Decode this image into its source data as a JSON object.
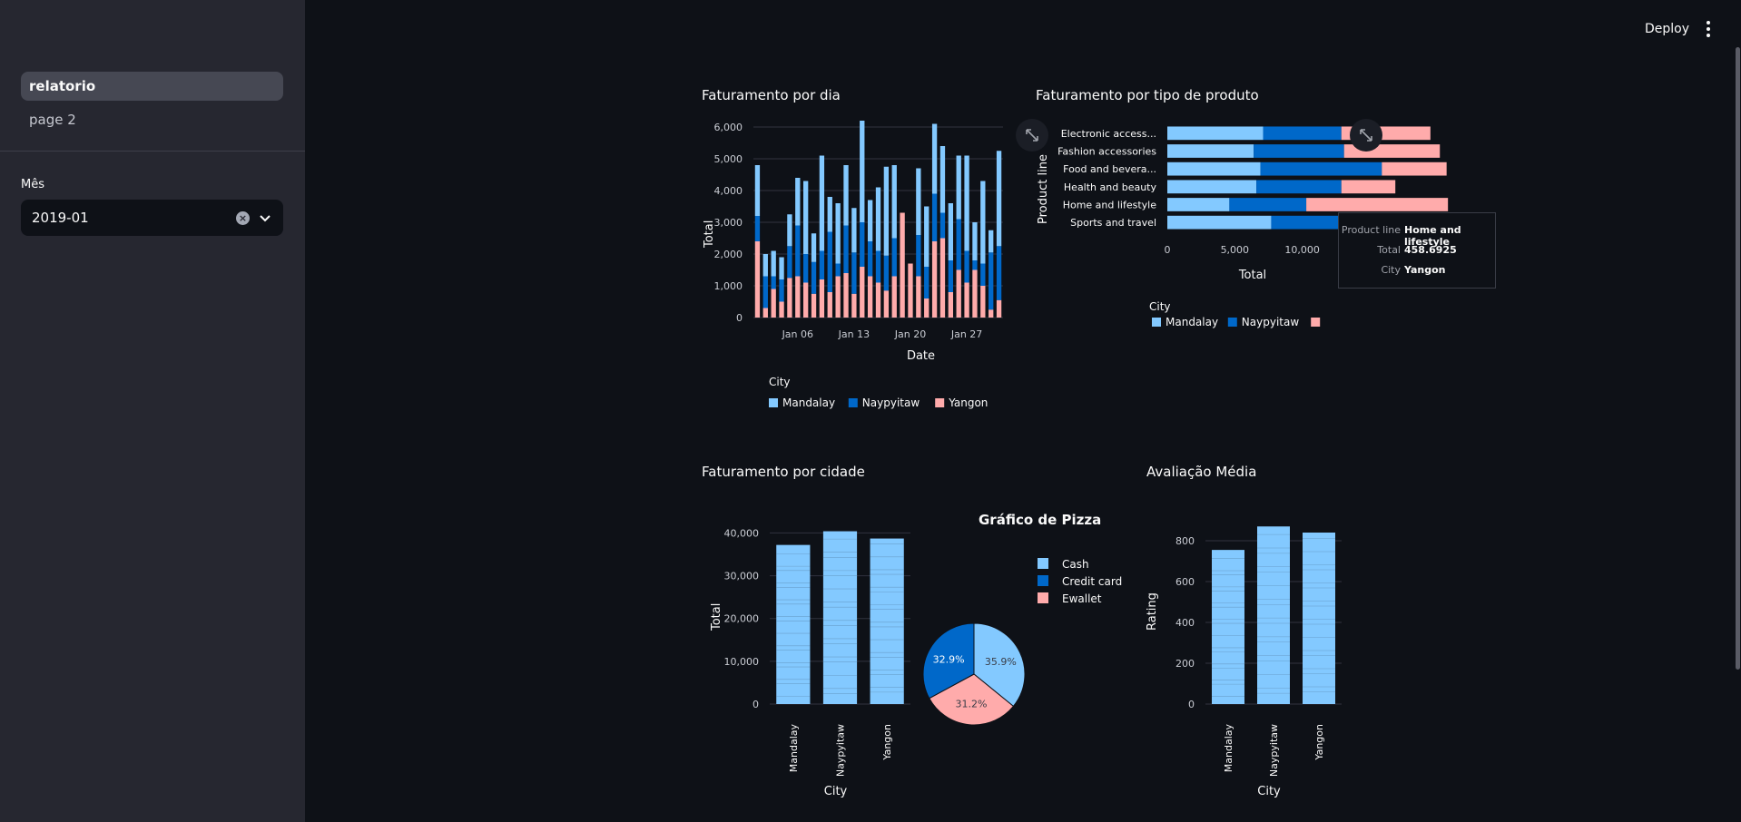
{
  "sidebar": {
    "nav": [
      {
        "label": "relatorio",
        "active": true
      },
      {
        "label": "page 2",
        "active": false
      }
    ],
    "month_label": "Mês",
    "month_value": "2019-01",
    "clear_icon": "clear-circle-icon",
    "dropdown_icon": "chevron-down-icon"
  },
  "header": {
    "deploy_label": "Deploy",
    "menu_icon": "kebab-menu-icon"
  },
  "colors": {
    "Mandalay": "#83c9ff",
    "Naypyitaw": "#0068c9",
    "Yangon": "#ffabab",
    "background": "#0e1117",
    "sidebar": "#262730"
  },
  "titles": {
    "daily": "Faturamento por dia",
    "product": "Faturamento por tipo de produto",
    "city": "Faturamento por cidade",
    "pie": "Gráfico de Pizza",
    "rating": "Avaliação Média"
  },
  "tooltip": {
    "rows": [
      {
        "key": "Product line",
        "value": "Home and lifestyle"
      },
      {
        "key": "Total",
        "value": "458.6925"
      },
      {
        "key": "City",
        "value": "Yangon"
      }
    ]
  },
  "chart_data": [
    {
      "type": "bar",
      "stacked": true,
      "title": "Faturamento por dia",
      "xlabel": "Date",
      "ylabel": "Total",
      "ylim": [
        0,
        6000
      ],
      "yticks": [
        0,
        1000,
        2000,
        3000,
        4000,
        5000,
        6000
      ],
      "ytick_labels": [
        "0",
        "1,000",
        "2,000",
        "3,000",
        "4,000",
        "5,000",
        "6,000"
      ],
      "xtick_labels": [
        {
          "day": 6,
          "label": "Jan 06"
        },
        {
          "day": 13,
          "label": "Jan 13"
        },
        {
          "day": 20,
          "label": "Jan 20"
        },
        {
          "day": 27,
          "label": "Jan 27"
        }
      ],
      "days": [
        1,
        2,
        3,
        4,
        5,
        6,
        7,
        8,
        9,
        10,
        11,
        12,
        13,
        14,
        15,
        16,
        17,
        18,
        19,
        20,
        21,
        22,
        23,
        24,
        25,
        26,
        27,
        28,
        29,
        30,
        31
      ],
      "legend_title": "City",
      "series": [
        {
          "name": "Yangon",
          "values": [
            2400,
            300,
            900,
            500,
            1250,
            1300,
            1100,
            750,
            1200,
            800,
            1300,
            1400,
            750,
            1600,
            1300,
            1100,
            850,
            1300,
            3300,
            1700,
            1300,
            600,
            2400,
            2500,
            800,
            1500,
            1100,
            1500,
            1000,
            250,
            550
          ]
        },
        {
          "name": "Naypyitaw",
          "values": [
            800,
            1000,
            400,
            700,
            1000,
            1600,
            900,
            1000,
            900,
            1900,
            400,
            1500,
            1300,
            1400,
            1100,
            1000,
            1100,
            1200,
            0,
            0,
            1300,
            1000,
            1500,
            800,
            1000,
            1600,
            1000,
            300,
            700,
            1800,
            1700
          ]
        },
        {
          "name": "Mandalay",
          "values": [
            1600,
            700,
            800,
            700,
            1000,
            1500,
            2300,
            900,
            3000,
            1100,
            1900,
            1900,
            1400,
            3200,
            1300,
            2000,
            2800,
            2300,
            0,
            0,
            2100,
            1900,
            2200,
            2100,
            1800,
            2000,
            3000,
            1200,
            2600,
            700,
            3000
          ]
        }
      ]
    },
    {
      "type": "bar",
      "orientation": "horizontal",
      "stacked": true,
      "title": "Faturamento por tipo de produto",
      "xlabel": "Total",
      "ylabel": "Product line",
      "xlim": [
        0,
        20000
      ],
      "xticks": [
        0,
        5000,
        10000,
        15000,
        20000
      ],
      "xtick_labels": [
        "0",
        "5,000",
        "10,000",
        "15,000",
        "20,000"
      ],
      "categories": [
        "Electronic access...",
        "Fashion accessories",
        "Food and bevera...",
        "Health and beauty",
        "Home and lifestyle",
        "Sports and travel"
      ],
      "legend_title": "City",
      "series": [
        {
          "name": "Mandalay",
          "values": [
            7100,
            6400,
            6900,
            6600,
            4600,
            7700
          ]
        },
        {
          "name": "Naypyitaw",
          "values": [
            5800,
            6700,
            9000,
            6300,
            5700,
            7800
          ]
        },
        {
          "name": "Yangon",
          "values": [
            6600,
            7100,
            4800,
            4000,
            10500,
            7400
          ]
        }
      ]
    },
    {
      "type": "bar",
      "title": "Faturamento por cidade",
      "xlabel": "City",
      "ylabel": "Total",
      "ylim": [
        0,
        42000
      ],
      "yticks": [
        0,
        10000,
        20000,
        30000,
        40000
      ],
      "ytick_labels": [
        "0",
        "10,000",
        "20,000",
        "30,000",
        "40,000"
      ],
      "categories": [
        "Mandalay",
        "Naypyitaw",
        "Yangon"
      ],
      "values": [
        37200,
        40400,
        38700
      ]
    },
    {
      "type": "pie",
      "title": "Gráfico de Pizza",
      "labels": [
        "Cash",
        "Credit card",
        "Ewallet"
      ],
      "values": [
        35.9,
        32.9,
        31.2
      ],
      "value_labels": [
        "35.9%",
        "32.9%",
        "31.2%"
      ],
      "colors": [
        "#83c9ff",
        "#0068c9",
        "#ffabab"
      ]
    },
    {
      "type": "bar",
      "title": "Avaliação Média",
      "xlabel": "City",
      "ylabel": "Rating",
      "ylim": [
        0,
        880
      ],
      "yticks": [
        0,
        200,
        400,
        600,
        800
      ],
      "ytick_labels": [
        "0",
        "200",
        "400",
        "600",
        "800"
      ],
      "categories": [
        "Mandalay",
        "Naypyitaw",
        "Yangon"
      ],
      "values": [
        755,
        870,
        840
      ]
    }
  ]
}
